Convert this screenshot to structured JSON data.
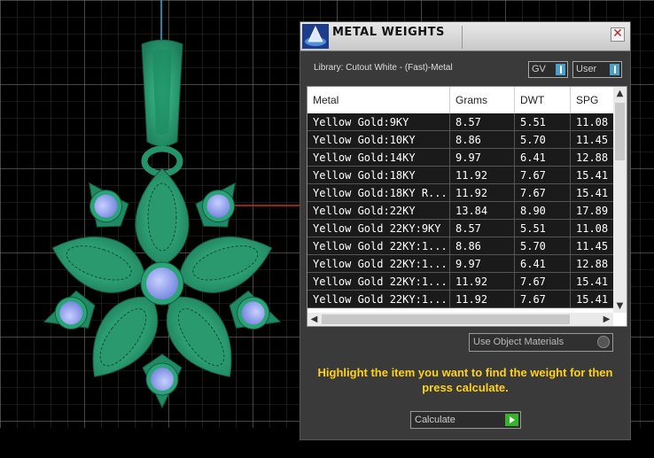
{
  "panel": {
    "title": "METAL WEIGHTS",
    "close_glyph": "✕",
    "library": "Library: Cutout White - (Fast)-Metal",
    "gv_label": "GV",
    "user_label": "User"
  },
  "table": {
    "headers": [
      "Metal",
      "Grams",
      "DWT",
      "SPG"
    ],
    "rows": [
      [
        "Yellow Gold:9KY",
        "8.57",
        "5.51",
        "11.08"
      ],
      [
        "Yellow Gold:10KY",
        "8.86",
        "5.70",
        "11.45"
      ],
      [
        "Yellow Gold:14KY",
        "9.97",
        "6.41",
        "12.88"
      ],
      [
        "Yellow Gold:18KY",
        "11.92",
        "7.67",
        "15.41"
      ],
      [
        "Yellow Gold:18KY R...",
        "11.92",
        "7.67",
        "15.41"
      ],
      [
        "Yellow Gold:22KY",
        "13.84",
        "8.90",
        "17.89"
      ],
      [
        "Yellow Gold 22KY:9KY",
        "8.57",
        "5.51",
        "11.08"
      ],
      [
        "Yellow Gold 22KY:1...",
        "8.86",
        "5.70",
        "11.45"
      ],
      [
        "Yellow Gold 22KY:1...",
        "9.97",
        "6.41",
        "12.88"
      ],
      [
        "Yellow Gold 22KY:1...",
        "11.92",
        "7.67",
        "15.41"
      ],
      [
        "Yellow Gold 22KY:1...",
        "11.92",
        "7.67",
        "15.41"
      ]
    ]
  },
  "use_object_materials": "Use Object Materials",
  "instruction": "Highlight the item you want to find the weight for then press calculate.",
  "calculate_label": "Calculate",
  "colors": {
    "metal": "#2aa377",
    "gem": "#8fa0ef",
    "instruction": "#ffd21a",
    "go": "#33b42a"
  }
}
